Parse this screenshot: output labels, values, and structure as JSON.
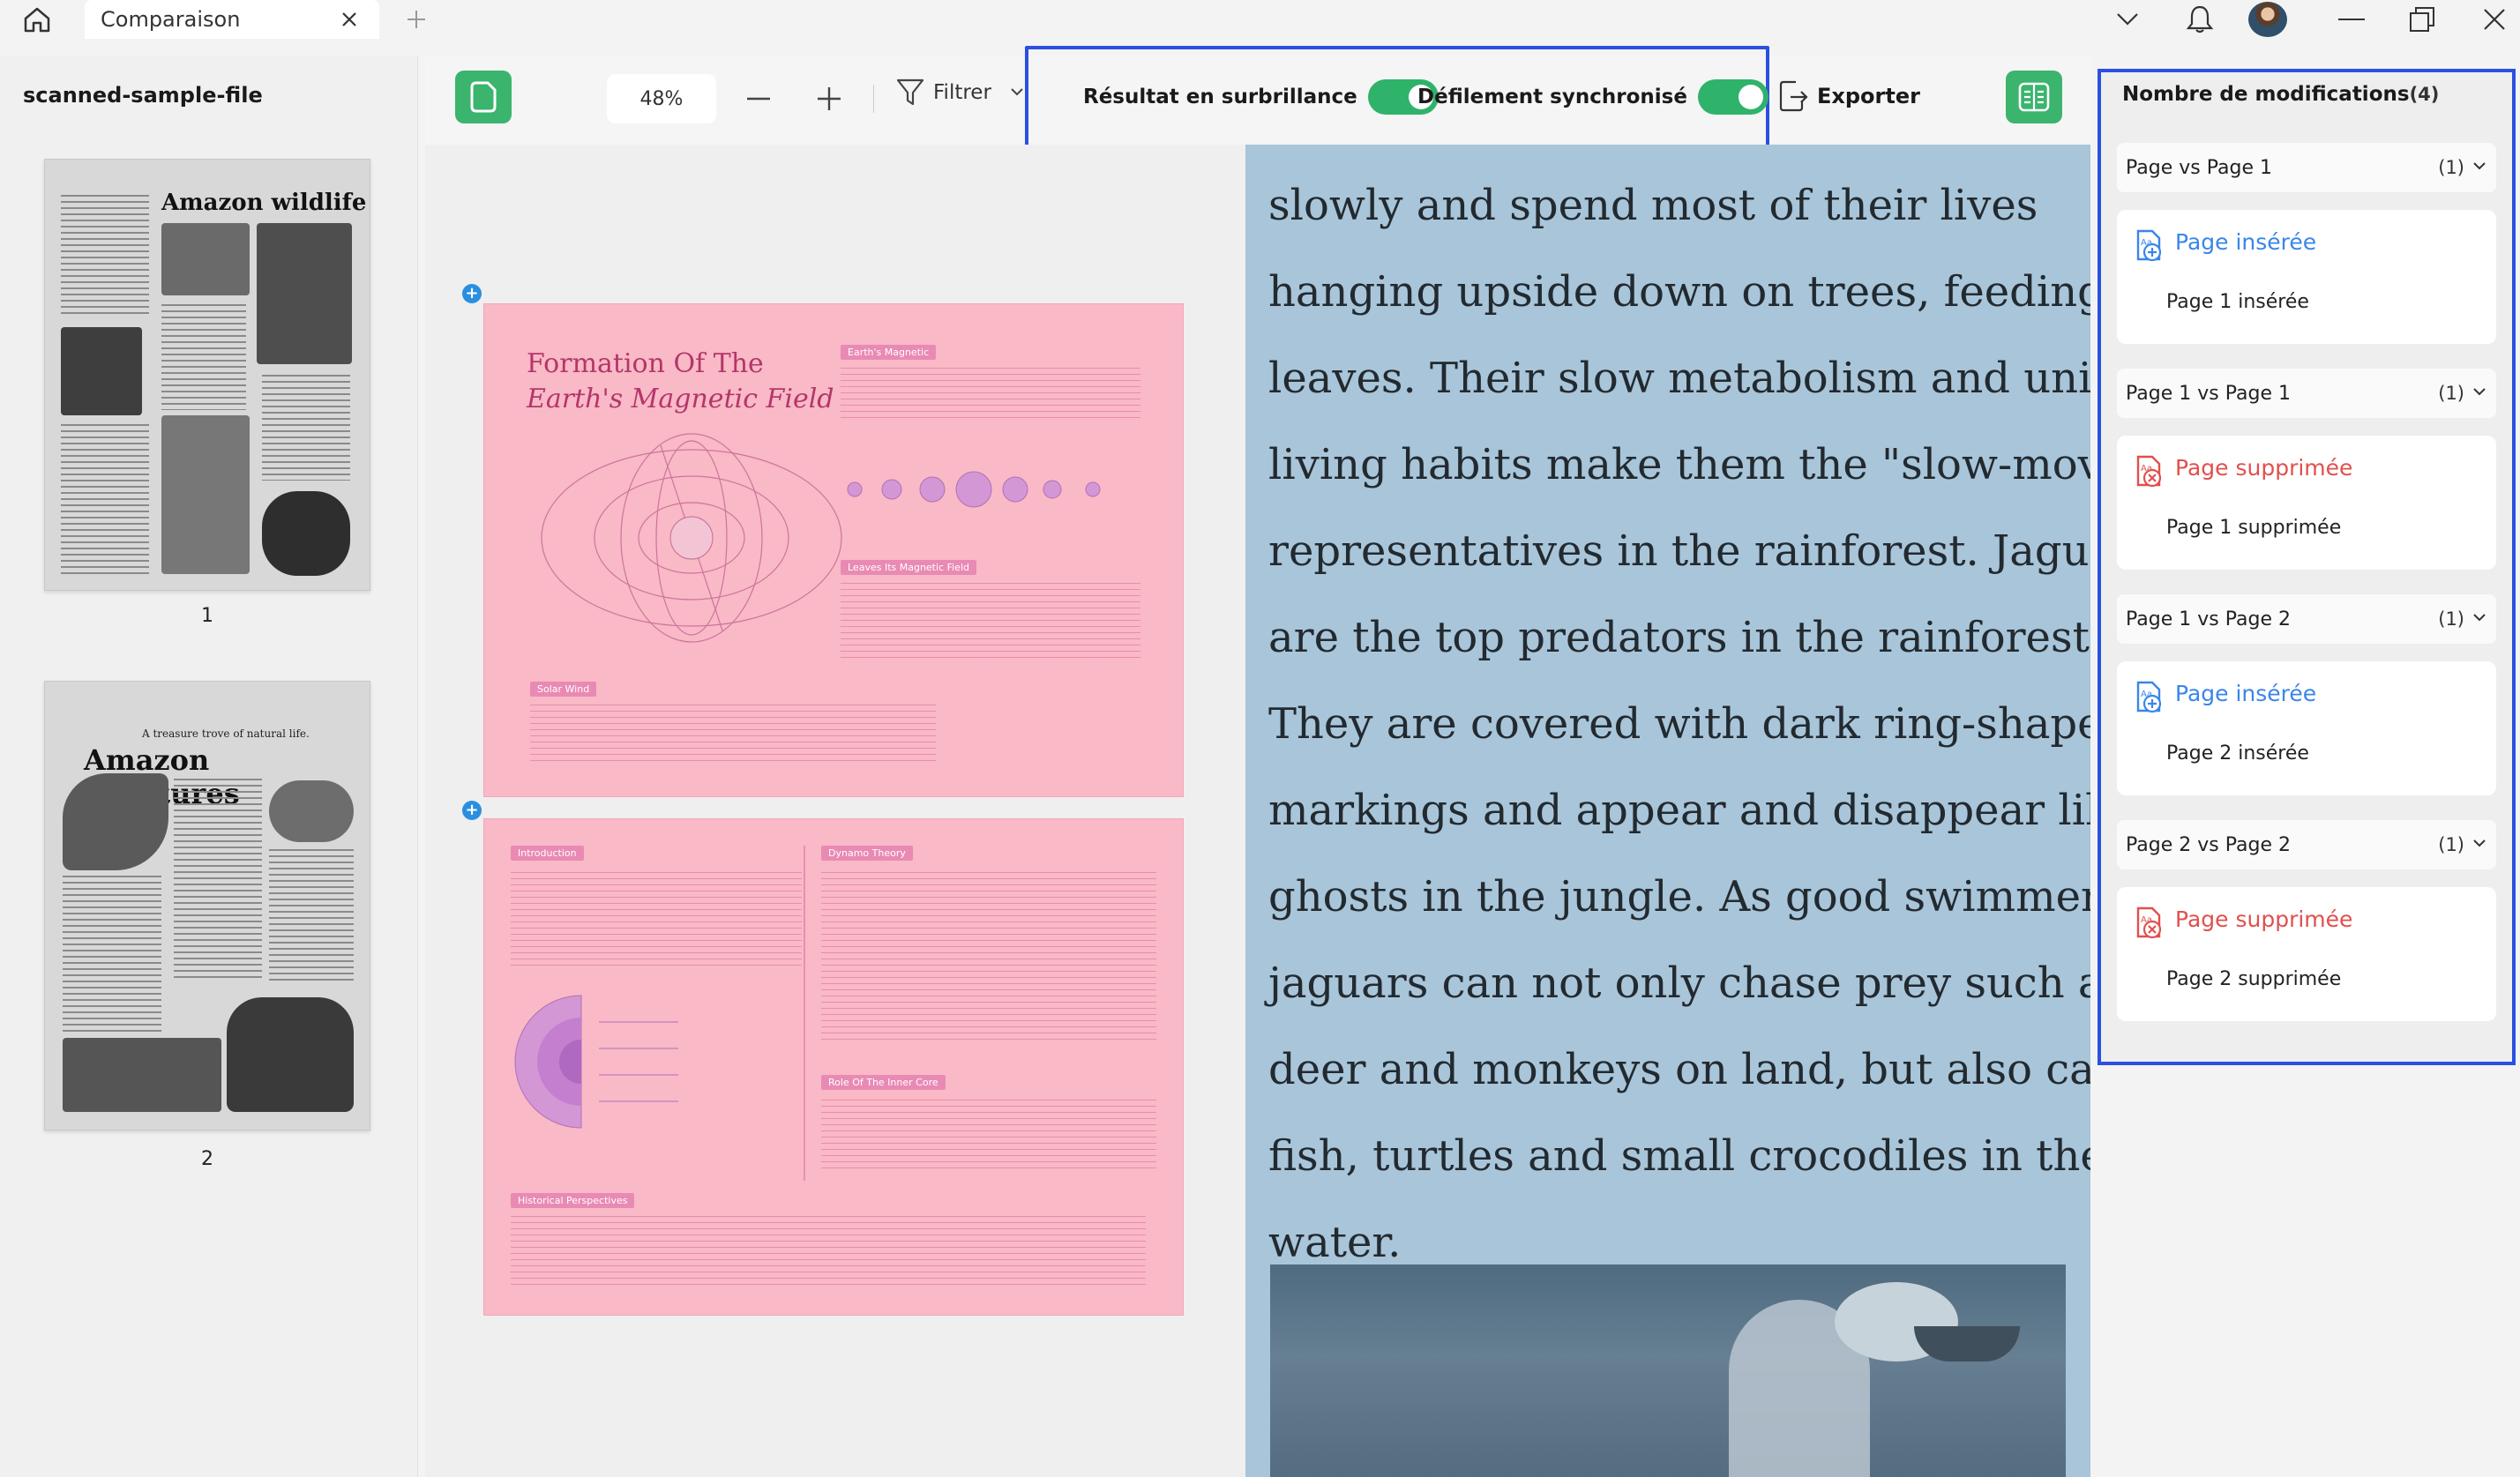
{
  "titlebar": {
    "tab_label": "Comparaison"
  },
  "left_panel": {
    "file_name": "scanned-sample-file",
    "thumbnails": [
      {
        "title": "Amazon wildlife",
        "page_number": "1"
      },
      {
        "subtitle": "A treasure trove of natural life.",
        "title": "Amazon Creatures",
        "page_number": "2"
      }
    ]
  },
  "toolbar": {
    "zoom": "48%",
    "filter_label": "Filtrer",
    "highlight_label": "Résultat en surbrillance",
    "sync_scroll_label": "Défilement synchronisé",
    "export_label": "Exporter",
    "highlight_on": true,
    "sync_scroll_on": true
  },
  "doc_left": {
    "page1_title_1": "Formation Of The",
    "page1_title_2": "Earth's Magnetic Field",
    "chips": [
      "Earth's Magnetic",
      "Leaves Its Magnetic Field",
      "Solar Wind",
      "Introduction",
      "Dynamo Theory",
      "Role Of The Inner Core",
      "Historical Perspectives"
    ]
  },
  "doc_right": {
    "lines": [
      "slowly and spend most of their lives",
      "hanging upside down on trees, feeding on",
      "leaves. Their slow metabolism and unique",
      "living habits make them the \"slow-moving",
      "representatives in the rainforest. Jaguars",
      "are the top predators in the rainforest.",
      "They are covered with dark ring-shaped",
      "markings and appear and disappear like",
      "ghosts in the jungle. As good swimmers,",
      "jaguars can not only chase prey such as",
      "deer and monkeys on land, but also catch",
      "fish, turtles and small crocodiles in the",
      "water."
    ]
  },
  "sidebar": {
    "title": "Nombre de modifications",
    "total": "(4)",
    "groups": [
      {
        "header": "Page  vs Page 1",
        "count": "(1)",
        "kind": "Page insérée",
        "type": "insert",
        "desc": "Page 1 insérée"
      },
      {
        "header": "Page 1 vs Page 1",
        "count": "(1)",
        "kind": "Page supprimée",
        "type": "delete",
        "desc": "Page 1 supprimée"
      },
      {
        "header": "Page 1 vs Page 2",
        "count": "(1)",
        "kind": "Page insérée",
        "type": "insert",
        "desc": "Page 2 insérée"
      },
      {
        "header": "Page 2 vs Page 2",
        "count": "(1)",
        "kind": "Page supprimée",
        "type": "delete",
        "desc": "Page 2 supprimée"
      }
    ]
  },
  "colors": {
    "accent_green": "#3bb46e",
    "toggle_green": "#2fb36a",
    "highlight_blue": "#2b50e0",
    "insert_blue": "#3a86e8",
    "delete_red": "#e0504e",
    "pink_page": "#f9b9c6",
    "scan_blue": "#a9c5d9"
  },
  "icons": [
    "home-icon",
    "close-icon",
    "plus-icon",
    "chevron-down-icon",
    "bell-icon",
    "minimize-icon",
    "restore-icon",
    "page-icon",
    "minus-icon",
    "filter-icon",
    "export-icon",
    "compare-icon",
    "page-insert-icon",
    "page-delete-icon"
  ]
}
